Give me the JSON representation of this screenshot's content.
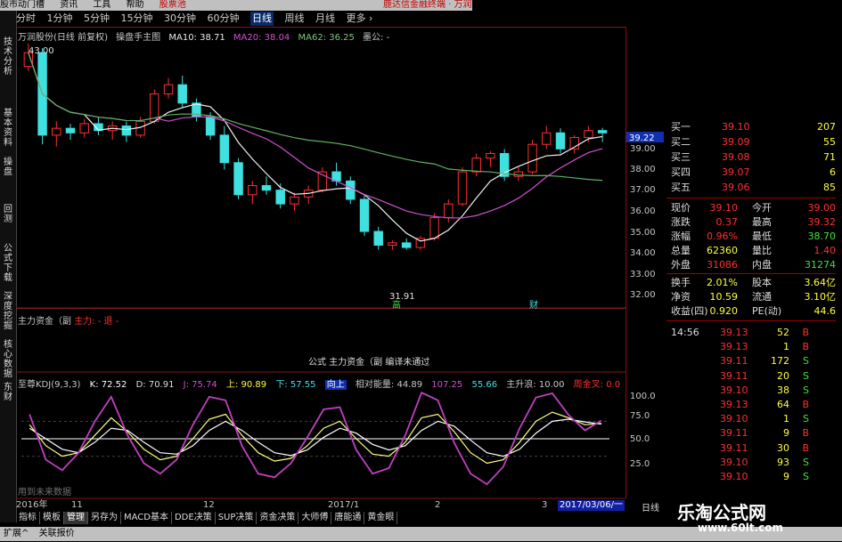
{
  "topbar": {
    "items": [
      "股市动门槽",
      "资讯",
      "工具",
      "帮助",
      "股票池"
    ],
    "right": "鹿达信金融终端 · 万润股"
  },
  "periods": [
    "分时",
    "1分钟",
    "5分钟",
    "15分钟",
    "30分钟",
    "60分钟",
    "日线",
    "周线",
    "月线",
    "更多 ›"
  ],
  "active_period": "日线",
  "sidetabs": [
    "技术分析",
    "基本资料",
    "操盘",
    "回测",
    "公式下载",
    "深度挖掘",
    "核心数据",
    "策略图谱",
    "东财"
  ],
  "info": {
    "stock": "万润股份(日线 前复权)",
    "template": "操盘手主图",
    "ma10": "MA10: 38.71",
    "ma20": "MA20: 38.04",
    "ma62": "MA62: 36.25",
    "note": "墨公: -"
  },
  "price_labels": {
    "high": "43.00",
    "low": "31.91",
    "current": "39.22",
    "xiang": "高",
    "cai": "财"
  },
  "zhuli": {
    "label": "主力资金（副",
    "red": "主力: -",
    "red2": "退 -"
  },
  "formula_msg": "公式 主力资金（副 编译未通过",
  "kdj": {
    "name": "至尊KDJ(9,3,3)",
    "k": "K: 72.52",
    "d": "D: 70.91",
    "j": "J: 75.74",
    "up": "上: 90.89",
    "down": "下: 57.55",
    "mid": "向上",
    "energy": "相对能量: 44.89",
    "v1": "107.25",
    "v2": "55.66",
    "trend": "主升浪: 10.00",
    "gold": "周金叉: 0.0"
  },
  "kdj_ticks": [
    "100.0",
    "75.0",
    "50.0",
    "25.0"
  ],
  "price_ticks": [
    "39.00",
    "38.00",
    "37.00",
    "36.00",
    "35.00",
    "34.00",
    "33.00",
    "32.00"
  ],
  "tmp_label": "用到未来数据",
  "dates": [
    "2016年",
    "11",
    "12",
    "2017/1",
    "2",
    "3"
  ],
  "date_box": "2017/03/06/一",
  "day_label": "日线",
  "bottom_tabs": [
    "指标",
    "模板",
    "管理",
    "另存为",
    "MACD基本",
    "DDE决策",
    "SUP决策",
    "资金决策",
    "大师傅",
    "唐能通",
    "黄金眼"
  ],
  "selected_bottom": "管理",
  "footer_tabs": [
    "扩展^",
    "关联报价"
  ],
  "asks": [
    {
      "l": "买一",
      "p": "39.10",
      "v": "207"
    },
    {
      "l": "买二",
      "p": "39.09",
      "v": "55"
    },
    {
      "l": "买三",
      "p": "39.08",
      "v": "71"
    },
    {
      "l": "买四",
      "p": "39.07",
      "v": "6"
    },
    {
      "l": "买五",
      "p": "39.06",
      "v": "85"
    }
  ],
  "quote": [
    {
      "l": "现价",
      "v": "39.10",
      "l2": "今开",
      "v2": "39.00",
      "c": "#ff3030",
      "c2": "#ff3030"
    },
    {
      "l": "涨跌",
      "v": "0.37",
      "l2": "最高",
      "v2": "39.32",
      "c": "#ff3030",
      "c2": "#ff3030"
    },
    {
      "l": "涨幅",
      "v": "0.96%",
      "l2": "最低",
      "v2": "38.70",
      "c": "#ff3030",
      "c2": "#40e040"
    },
    {
      "l": "总量",
      "v": "62360",
      "l2": "量比",
      "v2": "1.40",
      "c": "#ffff40",
      "c2": "#ff3030"
    },
    {
      "l": "外盘",
      "v": "31086",
      "l2": "内盘",
      "v2": "31274",
      "c": "#ff3030",
      "c2": "#40e040"
    },
    {
      "l": "换手",
      "v": "2.01%",
      "l2": "股本",
      "v2": "3.64亿",
      "c": "#ffff40",
      "c2": "#ffff40"
    },
    {
      "l": "净资",
      "v": "10.59",
      "l2": "流通",
      "v2": "3.10亿",
      "c": "#ffff40",
      "c2": "#ffff40"
    },
    {
      "l": "收益(四)",
      "v": "0.920",
      "l2": "PE(动)",
      "v2": "44.6",
      "c": "#ffff40",
      "c2": "#ffff40"
    }
  ],
  "ticks_time": "14:56",
  "trades": [
    {
      "p": "39.13",
      "v": "52",
      "s": "B"
    },
    {
      "p": "39.13",
      "v": "1",
      "s": "B"
    },
    {
      "p": "39.11",
      "v": "172",
      "s": "S"
    },
    {
      "p": "39.11",
      "v": "20",
      "s": "S"
    },
    {
      "p": "39.10",
      "v": "38",
      "s": "S"
    },
    {
      "p": "39.13",
      "v": "64",
      "s": "B"
    },
    {
      "p": "39.10",
      "v": "1",
      "s": "S"
    },
    {
      "p": "39.11",
      "v": "9",
      "s": "B"
    },
    {
      "p": "39.11",
      "v": "30",
      "s": "B"
    },
    {
      "p": "39.10",
      "v": "93",
      "s": "S"
    },
    {
      "p": "39.10",
      "v": "9",
      "s": "S"
    }
  ],
  "watermark": {
    "title": "乐淘公式网",
    "url": "www.60lt.com"
  },
  "chart_data": {
    "type": "candlestick",
    "series": [
      {
        "name": "K线",
        "points": [
          [
            42.0,
            43.0,
            41.8,
            42.6
          ],
          [
            42.6,
            42.8,
            38.6,
            39.0
          ],
          [
            39.0,
            39.6,
            38.5,
            39.3
          ],
          [
            39.3,
            39.5,
            38.8,
            39.1
          ],
          [
            39.1,
            39.7,
            38.9,
            39.5
          ],
          [
            39.5,
            39.8,
            39.0,
            39.2
          ],
          [
            39.2,
            39.6,
            38.8,
            39.4
          ],
          [
            39.4,
            39.6,
            38.7,
            39.0
          ],
          [
            39.0,
            39.8,
            38.9,
            39.6
          ],
          [
            39.6,
            41.0,
            39.5,
            40.8
          ],
          [
            40.8,
            41.5,
            40.6,
            41.2
          ],
          [
            41.2,
            41.6,
            40.2,
            40.4
          ],
          [
            40.4,
            40.6,
            39.6,
            39.8
          ],
          [
            39.8,
            40.0,
            38.8,
            39.0
          ],
          [
            39.0,
            39.4,
            37.5,
            37.8
          ],
          [
            37.8,
            38.0,
            36.2,
            36.4
          ],
          [
            36.4,
            37.0,
            36.0,
            36.8
          ],
          [
            36.8,
            37.2,
            36.4,
            36.6
          ],
          [
            36.6,
            36.9,
            35.8,
            36.0
          ],
          [
            36.0,
            36.5,
            35.7,
            36.3
          ],
          [
            36.3,
            36.8,
            36.0,
            36.6
          ],
          [
            36.6,
            37.6,
            36.5,
            37.4
          ],
          [
            37.4,
            37.8,
            36.8,
            37.0
          ],
          [
            37.0,
            37.2,
            36.0,
            36.2
          ],
          [
            36.2,
            36.4,
            34.6,
            34.8
          ],
          [
            34.8,
            35.0,
            34.0,
            34.2
          ],
          [
            34.2,
            34.4,
            34.0,
            34.3
          ],
          [
            34.3,
            34.5,
            34.0,
            34.1
          ],
          [
            34.1,
            34.6,
            34.0,
            34.5
          ],
          [
            34.5,
            35.6,
            34.4,
            35.4
          ],
          [
            35.4,
            36.2,
            35.2,
            36.0
          ],
          [
            36.0,
            37.6,
            35.9,
            37.4
          ],
          [
            37.4,
            38.2,
            37.2,
            38.0
          ],
          [
            38.0,
            38.3,
            37.6,
            38.2
          ],
          [
            38.2,
            38.4,
            37.0,
            37.2
          ],
          [
            37.2,
            37.6,
            37.0,
            37.4
          ],
          [
            37.4,
            38.8,
            37.3,
            38.6
          ],
          [
            38.6,
            39.4,
            38.4,
            39.1
          ],
          [
            39.1,
            39.3,
            38.2,
            38.4
          ],
          [
            38.4,
            39.0,
            38.2,
            38.9
          ],
          [
            38.9,
            39.4,
            38.7,
            39.2
          ],
          [
            39.2,
            39.32,
            38.7,
            39.1
          ]
        ]
      }
    ],
    "ylim": [
      31.5,
      43.5
    ],
    "kdj": {
      "k": [
        70,
        40,
        25,
        30,
        55,
        80,
        60,
        35,
        20,
        25,
        50,
        78,
        85,
        55,
        30,
        18,
        22,
        40,
        65,
        75,
        50,
        28,
        25,
        45,
        80,
        85,
        60,
        30,
        15,
        20,
        45,
        75,
        88,
        80,
        70,
        72
      ],
      "d": [
        65,
        50,
        35,
        30,
        45,
        65,
        62,
        45,
        30,
        28,
        40,
        62,
        75,
        62,
        45,
        30,
        26,
        34,
        52,
        65,
        58,
        42,
        34,
        40,
        62,
        75,
        68,
        48,
        30,
        25,
        35,
        58,
        75,
        78,
        74,
        71
      ],
      "j": [
        85,
        20,
        5,
        30,
        75,
        110,
        55,
        15,
        0,
        20,
        70,
        110,
        105,
        40,
        0,
        -5,
        15,
        52,
        92,
        95,
        34,
        0,
        8,
        55,
        116,
        105,
        44,
        0,
        -15,
        10,
        65,
        109,
        115,
        84,
        62,
        76
      ]
    },
    "kdj_ylim": [
      -20,
      120
    ]
  }
}
